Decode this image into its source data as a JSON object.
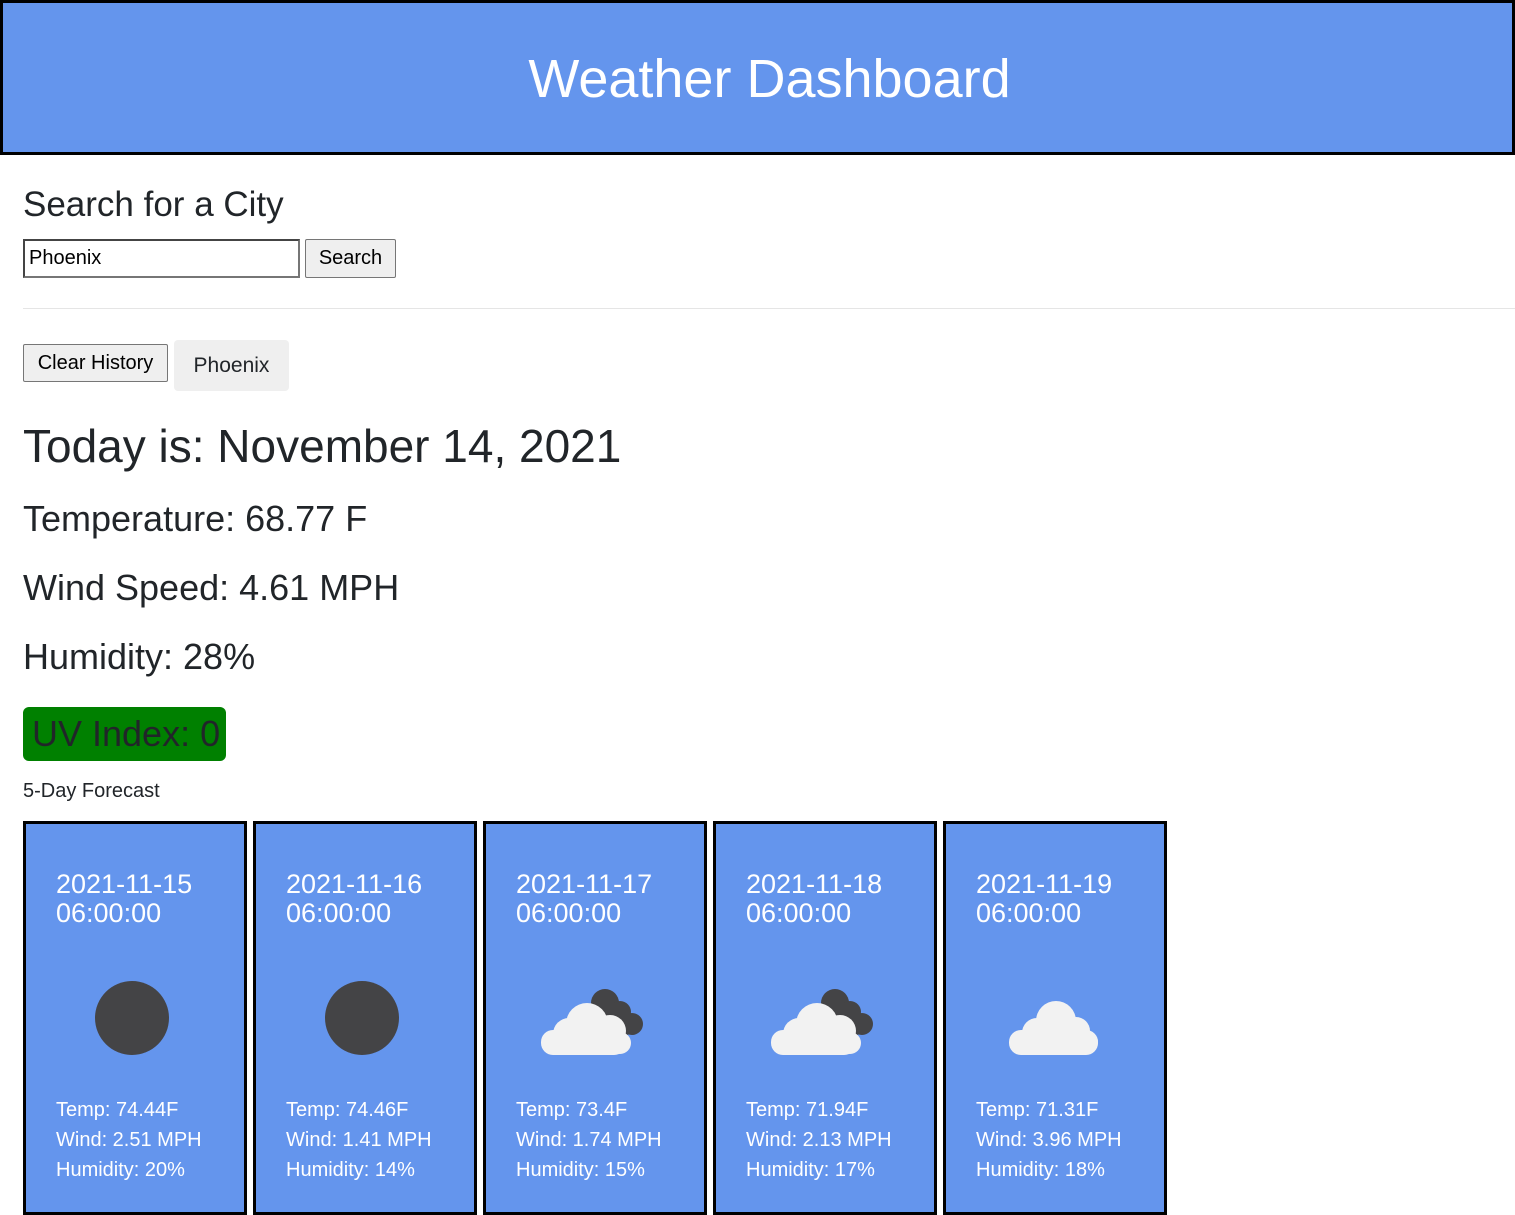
{
  "header": {
    "title": "Weather Dashboard"
  },
  "search": {
    "heading": "Search for a City",
    "input_value": "Phoenix",
    "button_label": "Search"
  },
  "history": {
    "clear_label": "Clear History",
    "items": [
      "Phoenix"
    ]
  },
  "current": {
    "today": "Today is: November 14, 2021",
    "temperature": "Temperature: 68.77 F",
    "wind": "Wind Speed: 4.61 MPH",
    "humidity": "Humidity: 28%",
    "uv": "UV Index: 0",
    "uv_color": "#008000"
  },
  "forecast": {
    "label": "5-Day Forecast",
    "days": [
      {
        "date": "2021-11-15 06:00:00",
        "icon": "full-moon-icon",
        "temp": "Temp: 74.44F",
        "wind": "Wind: 2.51 MPH",
        "humidity": "Humidity: 20%"
      },
      {
        "date": "2021-11-16 06:00:00",
        "icon": "full-moon-icon",
        "temp": "Temp: 74.46F",
        "wind": "Wind: 1.41 MPH",
        "humidity": "Humidity: 14%"
      },
      {
        "date": "2021-11-17 06:00:00",
        "icon": "night-clouds-icon",
        "temp": "Temp: 73.4F",
        "wind": "Wind: 1.74 MPH",
        "humidity": "Humidity: 15%"
      },
      {
        "date": "2021-11-18 06:00:00",
        "icon": "night-clouds-icon",
        "temp": "Temp: 71.94F",
        "wind": "Wind: 2.13 MPH",
        "humidity": "Humidity: 17%"
      },
      {
        "date": "2021-11-19 06:00:00",
        "icon": "cloud-icon",
        "temp": "Temp: 71.31F",
        "wind": "Wind: 3.96 MPH",
        "humidity": "Humidity: 18%"
      }
    ]
  },
  "colors": {
    "accent": "#6495ed",
    "border": "#000000",
    "uv_low": "#008000"
  }
}
